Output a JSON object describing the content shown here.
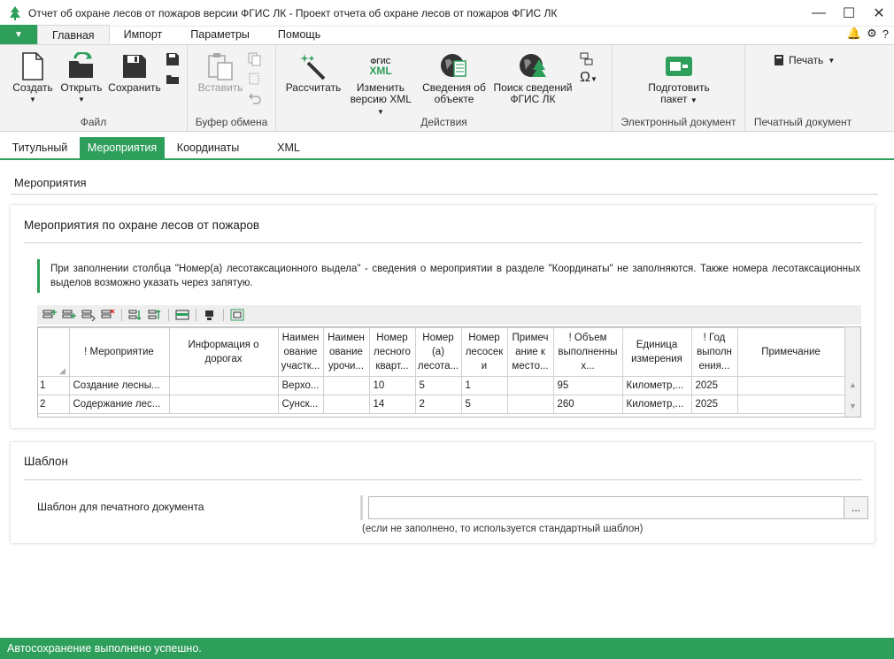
{
  "window": {
    "title": "Отчет об охране лесов от пожаров версии ФГИС ЛК - Проект отчета об охране лесов от пожаров ФГИС ЛК"
  },
  "menu": {
    "file_symbol": "▼",
    "tabs": [
      "Главная",
      "Импорт",
      "Параметры",
      "Помощь"
    ],
    "active_tab": 0
  },
  "ribbon": {
    "file": {
      "label": "Файл",
      "create": "Создать",
      "open": "Открыть",
      "save": "Сохранить"
    },
    "clipboard": {
      "label": "Буфер обмена",
      "paste": "Вставить"
    },
    "actions": {
      "label": "Действия",
      "calculate": "Рассчитать",
      "xml_logo_top": "ФГИС",
      "xml_logo_bottom": "XML",
      "change_xml_line1": "Изменить",
      "change_xml_line2": "версию XML",
      "object_info_line1": "Сведения об",
      "object_info_line2": "объекте",
      "fgis_search_line1": "Поиск сведений",
      "fgis_search_line2": "ФГИС ЛК"
    },
    "edoc": {
      "label": "Электронный документ",
      "prepare_line1": "Подготовить",
      "prepare_line2": "пакет"
    },
    "print": {
      "label": "Печатный документ",
      "print": "Печать"
    }
  },
  "doc_tabs": [
    "Титульный",
    "Мероприятия",
    "Координаты",
    "XML"
  ],
  "active_doc_tab": 1,
  "section_title": "Мероприятия",
  "measures_card": {
    "title": "Мероприятия по охране лесов от пожаров",
    "note": "При заполнении столбца \"Номер(а) лесотаксационного выдела\" - сведения о мероприятии в разделе \"Координаты\" не заполняются. Также номера лесотаксационных выделов возможно указать через запятую.",
    "columns": [
      "! Мероприятие",
      "Информация о дорогах",
      "Наимен ование участк...",
      "Наимен ование урочи...",
      "Номер лесного кварт...",
      "Номер (а) лесота...",
      "Номер лесосек и",
      "Примеч ание к место...",
      "! Объем выполненны х...",
      "Единица измерения",
      "! Год выполн ения...",
      "Примечание"
    ],
    "rows": [
      {
        "n": "1",
        "cells": [
          "Создание лесны...",
          "",
          "Верхо...",
          "",
          "10",
          "5",
          "1",
          "",
          "95",
          "Километр,...",
          "2025",
          ""
        ]
      },
      {
        "n": "2",
        "cells": [
          "Содержание лес...",
          "",
          "Сунск...",
          "",
          "14",
          "2",
          "5",
          "",
          "260",
          "Километр,...",
          "2025",
          ""
        ]
      }
    ]
  },
  "template_card": {
    "title": "Шаблон",
    "label": "Шаблон для печатного документа",
    "value": "",
    "browse": "...",
    "hint": "(если не заполнено, то используется стандартный шаблон)"
  },
  "status": {
    "text": "Автосохранение выполнено успешно."
  },
  "colors": {
    "accent": "#2e9e5b",
    "ribbon_bg": "#f3f3f3"
  },
  "icons": [
    "app-icon",
    "minimize-icon",
    "maximize-icon",
    "close-icon",
    "bell-icon",
    "settings-icon",
    "help-icon",
    "new-document-icon",
    "open-folder-icon",
    "save-disk-icon",
    "paste-clipboard-icon",
    "magic-wand-icon",
    "fgis-xml-icon",
    "globe-document-icon",
    "globe-tree-icon",
    "omega-icon",
    "package-icon",
    "printer-icon"
  ]
}
